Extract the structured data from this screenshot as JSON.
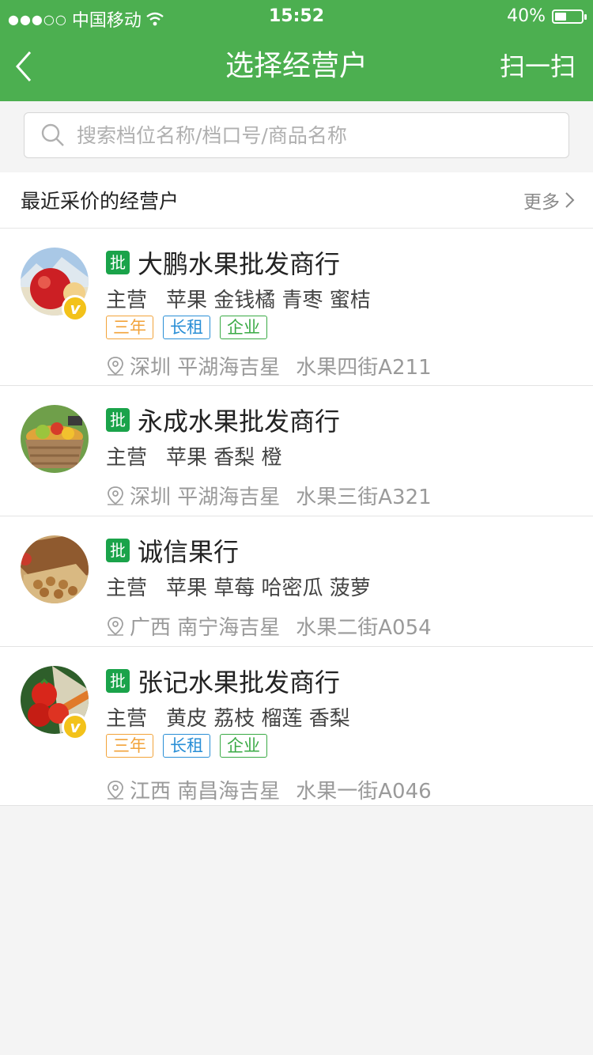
{
  "status": {
    "carrier": "中国移动",
    "time": "15:52",
    "battery": "40%"
  },
  "nav": {
    "title": "选择经营户",
    "scan_label": "扫一扫"
  },
  "search": {
    "placeholder": "搜索档位名称/档口号/商品名称"
  },
  "section": {
    "title": "最近采价的经营户",
    "more": "更多"
  },
  "merchants": [
    {
      "badge": "批",
      "name": "大鹏水果批发商行",
      "main_label": "主营",
      "products": "苹果 金钱橘 青枣 蜜桔",
      "tags": [
        "三年",
        "长租",
        "企业"
      ],
      "city": "深圳 平湖海吉星",
      "stall": "水果四街A211",
      "verified": "v"
    },
    {
      "badge": "批",
      "name": "永成水果批发商行",
      "main_label": "主营",
      "products": "苹果 香梨 橙",
      "city": "深圳 平湖海吉星",
      "stall": "水果三街A321"
    },
    {
      "badge": "批",
      "name": "诚信果行",
      "main_label": "主营",
      "products": "苹果 草莓 哈密瓜 菠萝",
      "city": "广西 南宁海吉星",
      "stall": "水果二街A054"
    },
    {
      "badge": "批",
      "name": "张记水果批发商行",
      "main_label": "主营",
      "products": "黄皮 荔枝 榴莲 香梨",
      "tags": [
        "三年",
        "长租",
        "企业"
      ],
      "city": "江西 南昌海吉星",
      "stall": "水果一街A046",
      "verified": "v"
    }
  ]
}
